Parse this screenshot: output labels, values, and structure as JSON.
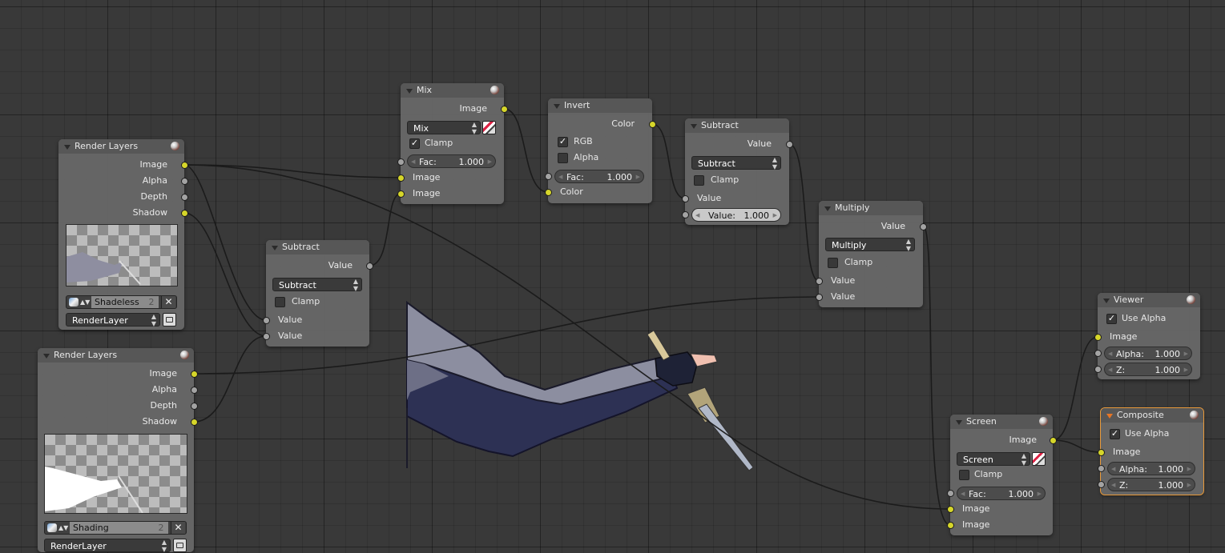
{
  "editor": {
    "type": "Compositor node editor"
  },
  "colors": {
    "socket_image": "#d6d62a",
    "socket_value": "#a3a3a3",
    "wire": "#1a1a1a",
    "active_outline": "#e99a3a"
  },
  "nodes": {
    "render_layers_1": {
      "title": "Render Layers",
      "outputs": [
        "Image",
        "Alpha",
        "Depth",
        "Shadow"
      ],
      "layer_name": "Shadeless",
      "layer_number": "2",
      "scene_layer": "RenderLayer"
    },
    "render_layers_2": {
      "title": "Render Layers",
      "outputs": [
        "Image",
        "Alpha",
        "Depth",
        "Shadow"
      ],
      "layer_name": "Shading",
      "layer_number": "2",
      "scene_layer": "RenderLayer"
    },
    "mix": {
      "title": "Mix",
      "output": "Image",
      "blend_mode": "Mix",
      "clamp_label": "Clamp",
      "clamp_checked": true,
      "fac_label": "Fac:",
      "fac_value": "1.000",
      "inputs": [
        "Image",
        "Image"
      ]
    },
    "invert": {
      "title": "Invert",
      "output": "Color",
      "rgb_label": "RGB",
      "rgb_checked": true,
      "alpha_label": "Alpha",
      "alpha_checked": false,
      "fac_label": "Fac:",
      "fac_value": "1.000",
      "input": "Color"
    },
    "subtract_1": {
      "title": "Subtract",
      "output": "Value",
      "operation": "Subtract",
      "clamp_label": "Clamp",
      "clamp_checked": false,
      "inputs": [
        "Value",
        "Value"
      ]
    },
    "subtract_2": {
      "title": "Subtract",
      "output": "Value",
      "operation": "Subtract",
      "clamp_label": "Clamp",
      "clamp_checked": false,
      "input": "Value",
      "value_label": "Value:",
      "value_value": "1.000"
    },
    "multiply": {
      "title": "Multiply",
      "output": "Value",
      "operation": "Multiply",
      "clamp_label": "Clamp",
      "clamp_checked": false,
      "inputs": [
        "Value",
        "Value"
      ]
    },
    "viewer": {
      "title": "Viewer",
      "use_alpha_label": "Use Alpha",
      "use_alpha_checked": true,
      "input": "Image",
      "alpha_label": "Alpha:",
      "alpha_value": "1.000",
      "z_label": "Z:",
      "z_value": "1.000"
    },
    "composite": {
      "title": "Composite",
      "use_alpha_label": "Use Alpha",
      "use_alpha_checked": true,
      "input": "Image",
      "alpha_label": "Alpha:",
      "alpha_value": "1.000",
      "z_label": "Z:",
      "z_value": "1.000"
    },
    "screen": {
      "title": "Screen",
      "output": "Image",
      "blend_mode": "Screen",
      "clamp_label": "Clamp",
      "clamp_checked": false,
      "fac_label": "Fac:",
      "fac_value": "1.000",
      "inputs": [
        "Image",
        "Image"
      ]
    }
  }
}
